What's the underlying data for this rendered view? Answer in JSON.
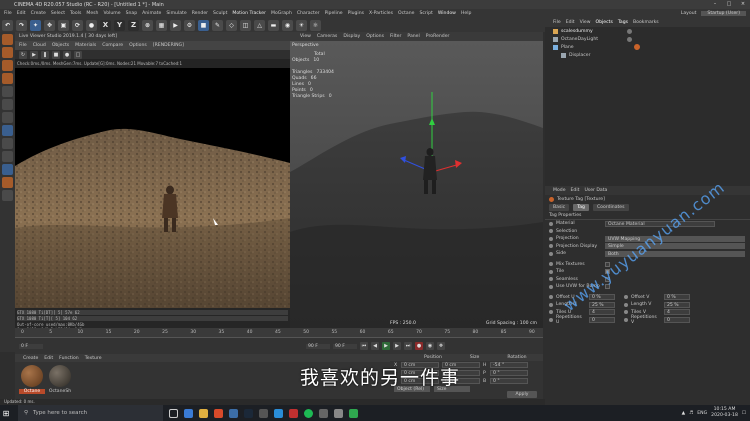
{
  "window": {
    "title": "CINEMA 4D R20.057 Studio (RC - R20) - [Untitled 1 *] - Main",
    "layout_label": "Layout",
    "layout_value": "Startup (User)"
  },
  "menubar": {
    "items": [
      "File",
      "Edit",
      "Create",
      "Select",
      "Tools",
      "Mesh",
      "Volume",
      "Snap",
      "Animate",
      "Simulate",
      "Render",
      "Sculpt",
      "Motion Tracker",
      "MoGraph",
      "Character",
      "Pipeline",
      "Plugins",
      "X-Particles",
      "Octane",
      "Script",
      "Window",
      "Help"
    ]
  },
  "toolbar": {
    "xyz": [
      "X",
      "Y",
      "Z"
    ]
  },
  "irv": {
    "title": "Live Viewer Studio 2019.1.4 [ 30 days left]",
    "menu": [
      "File",
      "Cloud",
      "Objects",
      "Materials",
      "Compare",
      "Options",
      "[RENDERING]"
    ],
    "info": "Check:0ms./0ms. MeshGen:7ms. Update[G]:0ms. Nodes:21 Movable:7 txCached:1",
    "status_lines": [
      "GTX 1080 Ti[DT][ 5] 57e 62",
      "GTX 1080 Ti[T][ 5] 104 62",
      "Out-of-core used/max:0Kb/4Gb",
      "Grey8/16: 0/0 Rgb32/64: 0/0",
      "Used/free/total vram: 3.265Gb/7.455Gb/11Gb",
      "Rendering: 1.562%  Ms/sec: 21.453  Time: 00 : 00:00 - 00 : 00 : 22  Spp/maxspp: 16/1024  Tri: 0/3  Mesh: 88  Hair: 0  RTX:off"
    ]
  },
  "viewport": {
    "menu": [
      "View",
      "Cameras",
      "Display",
      "Options",
      "Filter",
      "Panel",
      "ProRender"
    ],
    "camera": "Perspective",
    "stats_header": "Total",
    "stats": [
      {
        "label": "Objects",
        "value": "10"
      },
      {
        "label": "Triangles",
        "value": "733404"
      },
      {
        "label": "Quads",
        "value": "66"
      },
      {
        "label": "Lines",
        "value": "0"
      },
      {
        "label": "Points",
        "value": "0"
      },
      {
        "label": "Triangle Strips",
        "value": "0"
      }
    ],
    "fps": "FPS : 250.0",
    "grid_spacing": "Grid Spacing : 100 cm"
  },
  "timeline": {
    "ticks": [
      "0",
      "5",
      "10",
      "15",
      "20",
      "25",
      "30",
      "35",
      "40",
      "45",
      "50",
      "55",
      "60",
      "65",
      "70",
      "75",
      "80",
      "85",
      "90"
    ],
    "frame_start": "0 F",
    "frame_current": "0 F",
    "frame_end": "90 F",
    "frame_end2": "90 F"
  },
  "materials": {
    "menu": [
      "Create",
      "Edit",
      "Function",
      "Texture"
    ],
    "items": [
      {
        "name": "Octane",
        "color": "#7a4a25"
      },
      {
        "name": "OctaneSh",
        "color": "#4e463c"
      }
    ]
  },
  "coords": {
    "headers": [
      "Position",
      "Size",
      "Rotation"
    ],
    "rows": [
      {
        "axis": "X",
        "pos": "0 cm",
        "size": "0 cm",
        "rot_label": "H",
        "rot": "-54 °"
      },
      {
        "axis": "Y",
        "pos": "0 cm",
        "size": "0 cm",
        "rot_label": "P",
        "rot": "0 °"
      },
      {
        "axis": "Z",
        "pos": "0 cm",
        "size": "0 cm",
        "rot_label": "B",
        "rot": "0 °"
      }
    ],
    "mode1": "Object (Rel)",
    "mode2": "Size",
    "apply": "Apply"
  },
  "objects_panel": {
    "menu": [
      "File",
      "Edit",
      "View",
      "Objects",
      "Tags",
      "Bookmarks"
    ],
    "items": [
      {
        "name": "scalesdummy",
        "indent": 0,
        "color": "#d9a552"
      },
      {
        "name": "OctaneDayLight",
        "indent": 0,
        "color": "#9aa6b0"
      },
      {
        "name": "Plane",
        "indent": 0,
        "color": "#7ab0e0"
      },
      {
        "name": "Displacer",
        "indent": 1,
        "color": "#9aa6b0"
      }
    ]
  },
  "attributes": {
    "menu": [
      "Mode",
      "Edit",
      "User Data"
    ],
    "header": "Texture Tag [Texture]",
    "tabs": [
      "Basic",
      "Tag",
      "Coordinates"
    ],
    "active_tab": "Tag",
    "section": "Tag Properties",
    "fields": [
      {
        "label": "Material",
        "value": "Octane Material",
        "type": "field"
      },
      {
        "label": "Selection",
        "value": "",
        "type": "field"
      },
      {
        "label": "Projection",
        "value": "UVW Mapping",
        "type": "select"
      },
      {
        "label": "Projection Display",
        "value": "Simple",
        "type": "select"
      },
      {
        "label": "Side",
        "value": "Both",
        "type": "select"
      }
    ],
    "checks": [
      "Mix Textures",
      "Tile",
      "Seamless",
      "Use UVW for Bump"
    ],
    "pairs": [
      {
        "l1": "Offset U",
        "v1": "0 %",
        "l2": "Offset V",
        "v2": "0 %"
      },
      {
        "l1": "Length U",
        "v1": "25 %",
        "l2": "Length V",
        "v2": "25 %"
      },
      {
        "l1": "Tiles U",
        "v1": "4",
        "l2": "Tiles V",
        "v2": "4"
      },
      {
        "l1": "Repetitions U",
        "v1": "0",
        "l2": "Repetitions V",
        "v2": "0"
      }
    ]
  },
  "subtitle": "我喜欢的另一件事",
  "watermark": "www.yuyuanyuan.com",
  "statusbar": "Updated: 0 ms.",
  "taskbar": {
    "search_placeholder": "Type here to search",
    "lang": "ENG",
    "time": "10:15 AM",
    "date": "2020-03-18"
  },
  "colors": {
    "accent_orange": "#a55b2a",
    "accent_blue": "#3a5f8f",
    "gizmo_red": "#e03030",
    "gizmo_green": "#30d040",
    "gizmo_blue": "#3050e0"
  }
}
